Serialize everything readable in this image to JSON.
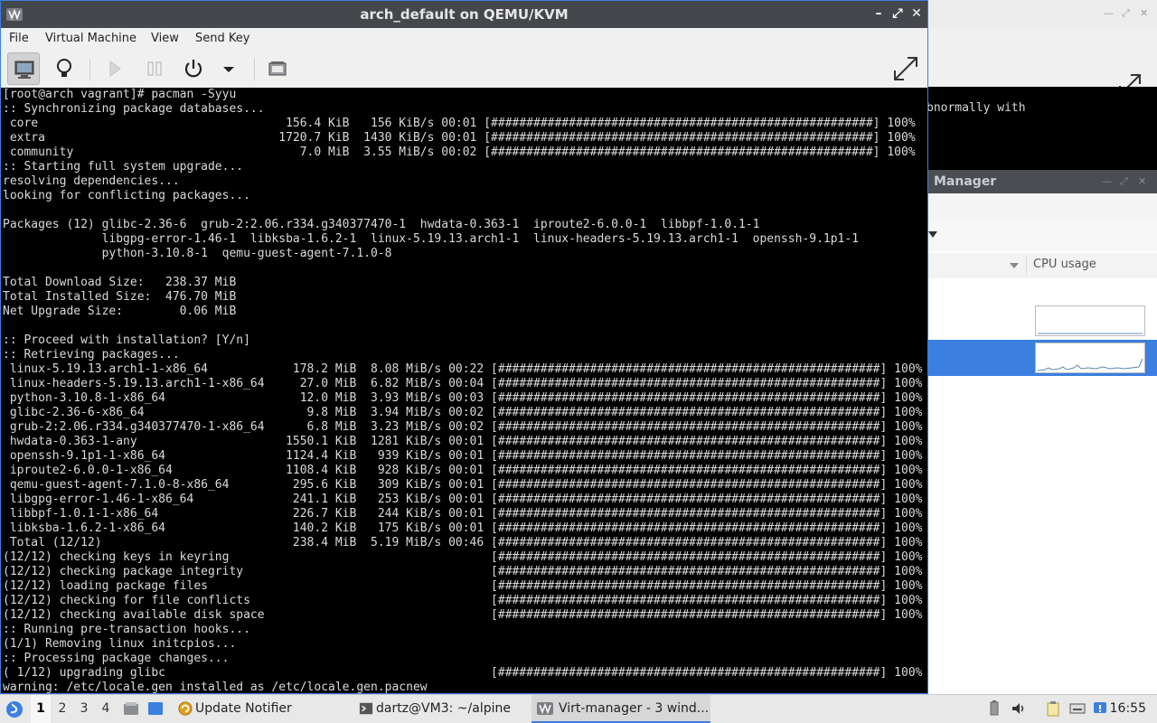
{
  "window": {
    "title": "arch_default on QEMU/KVM",
    "controls": {
      "minimize": "–",
      "maximize": "⤢",
      "close": "✕"
    }
  },
  "menubar": [
    "File",
    "Virtual Machine",
    "View",
    "Send Key"
  ],
  "toolbar": {
    "icons": [
      "monitor-icon",
      "lightbulb-icon",
      "play-icon",
      "pause-icon",
      "power-icon",
      "dropdown-arrow-icon",
      "screenshot-icon",
      "fullscreen-icon"
    ]
  },
  "console_lines": [
    "[root@arch vagrant]# pacman -Syyu",
    ":: Synchronizing package databases...",
    " core                                   156.4 KiB   156 KiB/s 00:01 [######################################################] 100%",
    " extra                                 1720.7 KiB  1430 KiB/s 00:01 [######################################################] 100%",
    " community                                7.0 MiB  3.55 MiB/s 00:02 [######################################################] 100%",
    ":: Starting full system upgrade...",
    "resolving dependencies...",
    "looking for conflicting packages...",
    "",
    "Packages (12) glibc-2.36-6  grub-2:2.06.r334.g340377470-1  hwdata-0.363-1  iproute2-6.0.0-1  libbpf-1.0.1-1",
    "              libgpg-error-1.46-1  libksba-1.6.2-1  linux-5.19.13.arch1-1  linux-headers-5.19.13.arch1-1  openssh-9.1p1-1",
    "              python-3.10.8-1  qemu-guest-agent-7.1.0-8",
    "",
    "Total Download Size:   238.37 MiB",
    "Total Installed Size:  476.70 MiB",
    "Net Upgrade Size:        0.06 MiB",
    "",
    ":: Proceed with installation? [Y/n]",
    ":: Retrieving packages...",
    " linux-5.19.13.arch1-1-x86_64            178.2 MiB  8.08 MiB/s 00:22 [######################################################] 100%",
    " linux-headers-5.19.13.arch1-1-x86_64     27.0 MiB  6.82 MiB/s 00:04 [######################################################] 100%",
    " python-3.10.8-1-x86_64                   12.0 MiB  3.93 MiB/s 00:03 [######################################################] 100%",
    " glibc-2.36-6-x86_64                       9.8 MiB  3.94 MiB/s 00:02 [######################################################] 100%",
    " grub-2:2.06.r334.g340377470-1-x86_64      6.8 MiB  3.23 MiB/s 00:02 [######################################################] 100%",
    " hwdata-0.363-1-any                     1550.1 KiB  1281 KiB/s 00:01 [######################################################] 100%",
    " openssh-9.1p1-1-x86_64                 1124.4 KiB   939 KiB/s 00:01 [######################################################] 100%",
    " iproute2-6.0.0-1-x86_64                1108.4 KiB   928 KiB/s 00:01 [######################################################] 100%",
    " qemu-guest-agent-7.1.0-8-x86_64         295.6 KiB   309 KiB/s 00:01 [######################################################] 100%",
    " libgpg-error-1.46-1-x86_64              241.1 KiB   253 KiB/s 00:01 [######################################################] 100%",
    " libbpf-1.0.1-1-x86_64                   226.7 KiB   244 KiB/s 00:01 [######################################################] 100%",
    " libksba-1.6.2-1-x86_64                  140.2 KiB   175 KiB/s 00:01 [######################################################] 100%",
    " Total (12/12)                           238.4 MiB  5.19 MiB/s 00:46 [######################################################] 100%",
    "(12/12) checking keys in keyring                                     [######################################################] 100%",
    "(12/12) checking package integrity                                   [######################################################] 100%",
    "(12/12) loading package files                                        [######################################################] 100%",
    "(12/12) checking for file conflicts                                  [######################################################] 100%",
    "(12/12) checking available disk space                                [######################################################] 100%",
    ":: Running pre-transaction hooks...",
    "(1/1) Removing linux initcpios...",
    ":: Processing package changes...",
    "( 1/12) upgrading glibc                                              [######################################################] 100%",
    "warning: /etc/locale.gen installed as /etc/locale.gen.pacnew"
  ],
  "background": {
    "terminal_text": "bnormally with",
    "manager": {
      "title": "Manager",
      "column_header": "CPU usage"
    }
  },
  "taskbar": {
    "workspaces": [
      "1",
      "2",
      "3",
      "4"
    ],
    "tasks": [
      {
        "label": "Update Notifier",
        "icon": "update-notifier-icon"
      },
      {
        "label": "dartz@VM3: ~/alpine",
        "icon": "terminal-icon"
      },
      {
        "label": "Virt-manager - 3 wind...",
        "icon": "virt-manager-icon"
      }
    ],
    "clock": "16:55"
  },
  "colors": {
    "accent": "#3b7fe0",
    "titlebar": "#44474c",
    "console_bg": "#000000",
    "console_fg": "#dadada"
  }
}
